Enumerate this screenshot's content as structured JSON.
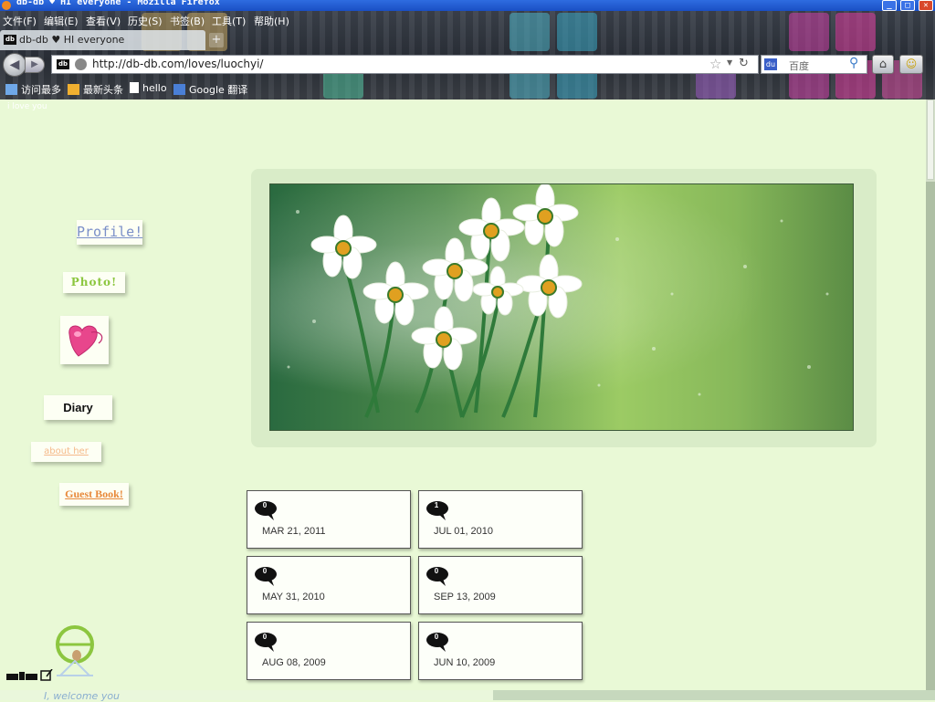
{
  "window": {
    "title": "db-db ♥ HI everyone - Mozilla Firefox",
    "buttons": {
      "minimize": "_",
      "maximize": "□",
      "close": "✕"
    }
  },
  "menubar": [
    "文件(F)",
    "编辑(E)",
    "查看(V)",
    "历史(S)",
    "书签(B)",
    "工具(T)",
    "帮助(H)"
  ],
  "tab": {
    "favicon_text": "db",
    "label": "db-db ♥ HI everyone",
    "new_tab": "+"
  },
  "nav": {
    "back": "◀",
    "forward": "▶",
    "url": "http://db-db.com/loves/luochyi/",
    "search_engine_text": "百度",
    "search_placeholder": "百度",
    "star_icon": "star-icon",
    "reload_icon": "reload-icon",
    "home_icon": "home-icon"
  },
  "bookmarks": [
    "访问最多",
    "最新头条",
    "hello",
    "Google 翻译"
  ],
  "page": {
    "top_note": "i love you",
    "nav_links": {
      "profile": "Profile!",
      "photo": "Photo!",
      "diary": "Diary",
      "about": "about her",
      "guestbook": "Guest Book!"
    },
    "entries": [
      {
        "count": "0",
        "date": "MAR 21, 2011"
      },
      {
        "count": "1",
        "date": "JUL 01, 2010"
      },
      {
        "count": "0",
        "date": "MAY 31, 2010"
      },
      {
        "count": "0",
        "date": "SEP 13, 2009"
      },
      {
        "count": "0",
        "date": "AUG 08, 2009"
      },
      {
        "count": "0",
        "date": "JUN 10, 2009"
      }
    ],
    "footer_text": "I, welcome you"
  },
  "colors": {
    "page_bg": "#e9f9d6",
    "photo_link": "#8cc63f",
    "profile_link": "#7a8fc8",
    "guestbook_link": "#e8893a",
    "heart": "#e8468c"
  }
}
